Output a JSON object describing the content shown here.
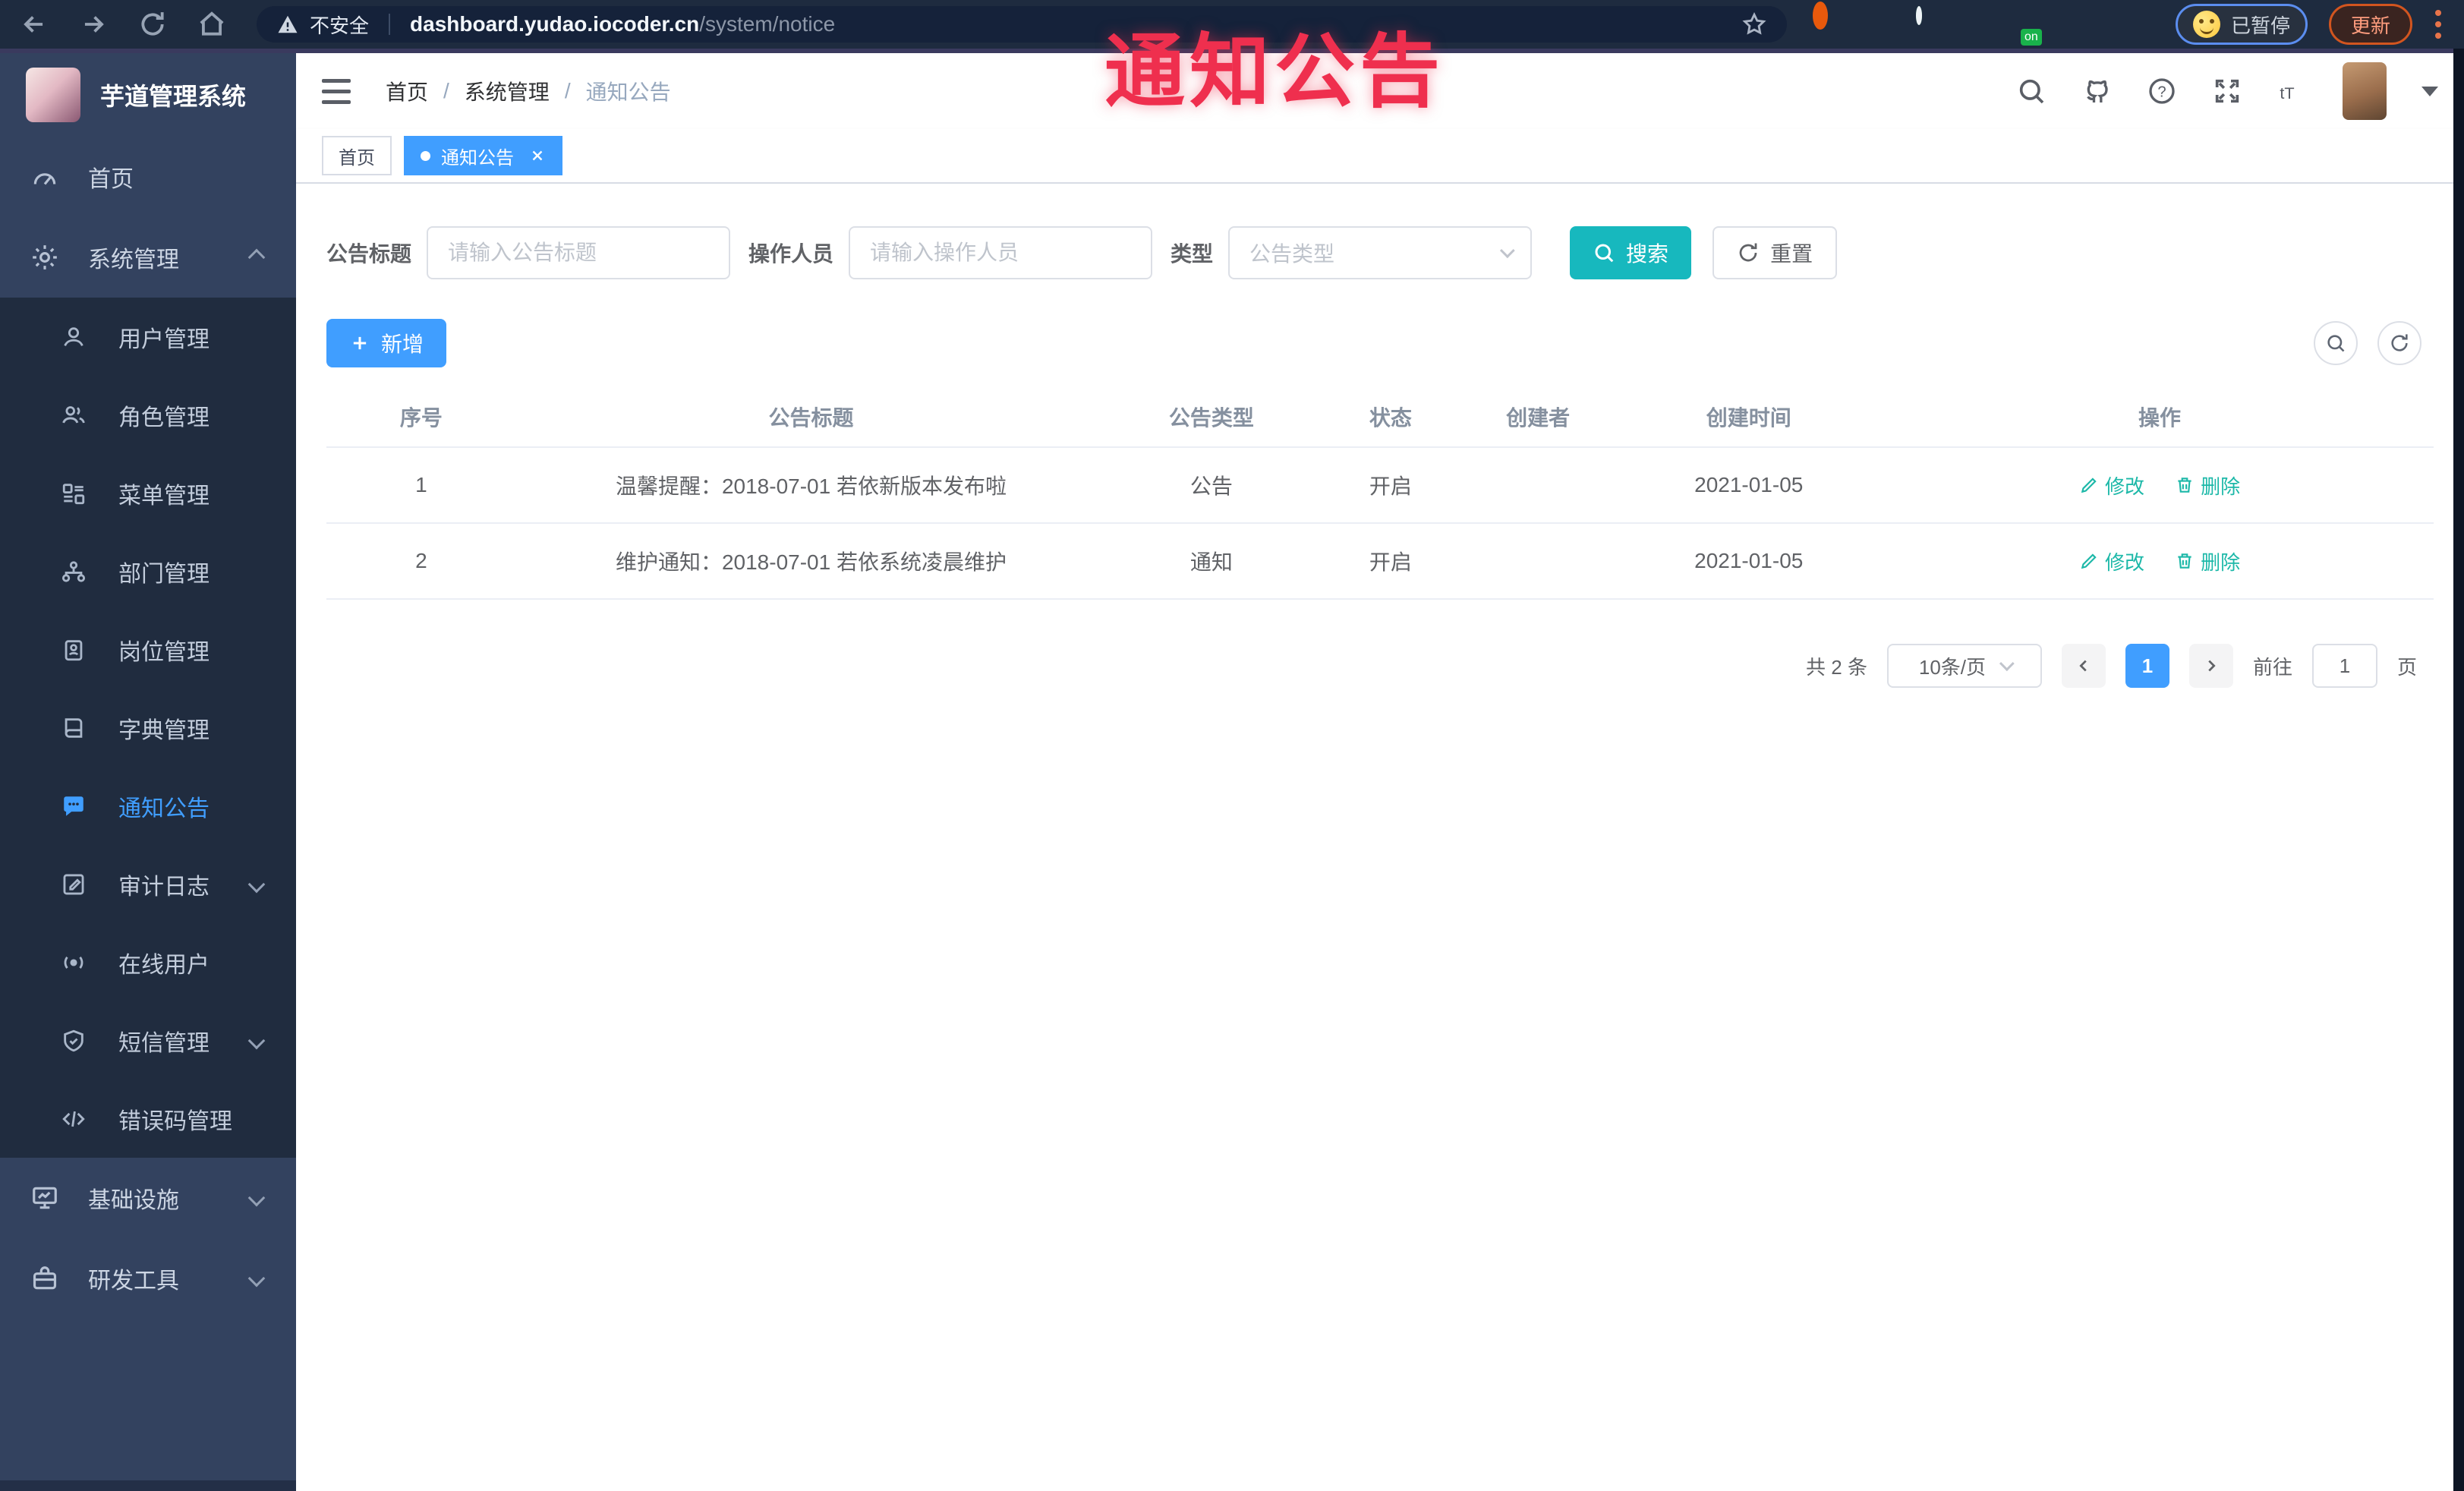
{
  "browser": {
    "security_text": "不安全",
    "url_domain": "dashboard.yudao.iocoder.cn",
    "url_path": "/system/notice",
    "paused_label": "已暂停",
    "update_label": "更新",
    "on_badge": "on"
  },
  "overlay": {
    "title": "通知公告"
  },
  "sidebar": {
    "logo_title": "芋道管理系统",
    "items": {
      "home": "首页",
      "system": "系统管理",
      "infra": "基础设施",
      "devtools": "研发工具"
    },
    "sub_items": [
      {
        "label": "用户管理"
      },
      {
        "label": "角色管理"
      },
      {
        "label": "菜单管理"
      },
      {
        "label": "部门管理"
      },
      {
        "label": "岗位管理"
      },
      {
        "label": "字典管理"
      },
      {
        "label": "通知公告"
      },
      {
        "label": "审计日志"
      },
      {
        "label": "在线用户"
      },
      {
        "label": "短信管理"
      },
      {
        "label": "错误码管理"
      }
    ]
  },
  "header": {
    "breadcrumb": [
      "首页",
      "系统管理",
      "通知公告"
    ],
    "breadcrumb_sep": "/"
  },
  "tags": [
    {
      "label": "首页"
    },
    {
      "label": "通知公告"
    }
  ],
  "filters": {
    "title_label": "公告标题",
    "title_placeholder": "请输入公告标题",
    "operator_label": "操作人员",
    "operator_placeholder": "请输入操作人员",
    "type_label": "类型",
    "type_placeholder": "公告类型",
    "search_label": "搜索",
    "reset_label": "重置"
  },
  "toolbar": {
    "add_label": "新增"
  },
  "table": {
    "columns": [
      "序号",
      "公告标题",
      "公告类型",
      "状态",
      "创建者",
      "创建时间",
      "操作"
    ],
    "rows": [
      {
        "no": "1",
        "title": "温馨提醒：2018-07-01 若依新版本发布啦",
        "type": "公告",
        "status": "开启",
        "creator": "",
        "time": "2021-01-05"
      },
      {
        "no": "2",
        "title": "维护通知：2018-07-01 若依系统凌晨维护",
        "type": "通知",
        "status": "开启",
        "creator": "",
        "time": "2021-01-05"
      }
    ],
    "edit_label": "修改",
    "delete_label": "删除"
  },
  "pagination": {
    "total_text": "共 2 条",
    "page_size": "10条/页",
    "current_page": "1",
    "goto_label": "前往",
    "goto_value": "1",
    "page_unit": "页"
  },
  "colors": {
    "accent": "#409eff",
    "teal": "#17b8be",
    "overlay_red": "#ef2f4e"
  }
}
